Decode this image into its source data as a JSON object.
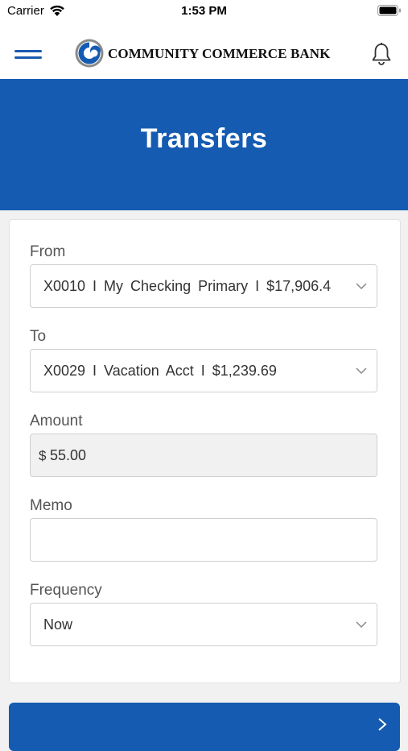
{
  "status_bar": {
    "carrier": "Carrier",
    "time": "1:53 PM"
  },
  "header": {
    "brand_name": "COMMUNITY COMMERCE BANK",
    "icons": [
      "menu-icon",
      "logo-mark",
      "bell-icon"
    ]
  },
  "banner": {
    "title": "Transfers"
  },
  "form": {
    "from": {
      "label": "From",
      "value": "X0010 I My Checking Primary I $17,906.4"
    },
    "to": {
      "label": "To",
      "value": "X0029 I Vacation Acct I $1,239.69"
    },
    "amount": {
      "label": "Amount",
      "currency": "$",
      "value": "55.00"
    },
    "memo": {
      "label": "Memo",
      "value": ""
    },
    "frequency": {
      "label": "Frequency",
      "value": "Now"
    }
  },
  "colors": {
    "primary": "#155bb1",
    "menu": "#1a5aaf",
    "background": "#f1f1f1"
  }
}
